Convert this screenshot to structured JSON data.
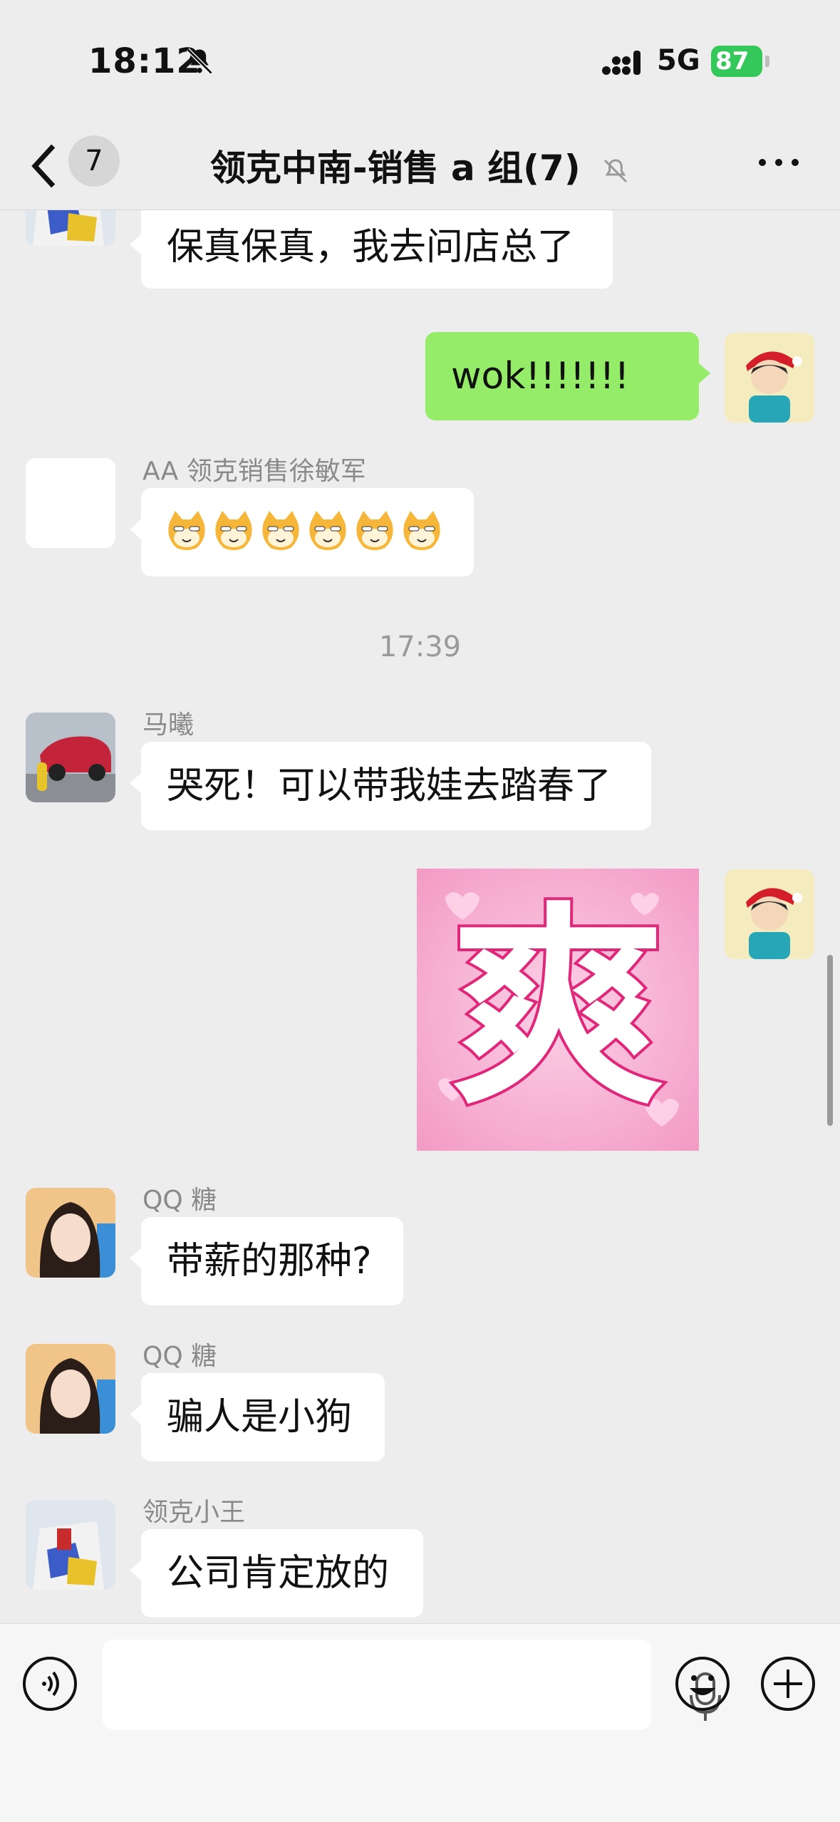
{
  "status_bar": {
    "time": "18:12",
    "network": "5G",
    "battery": "87"
  },
  "nav": {
    "unread_count": "7",
    "title": "领克中南-销售 a 组(7)"
  },
  "messages": [
    {
      "side": "left",
      "sender": "",
      "text": "保真保真，我去问店总了"
    },
    {
      "side": "right",
      "text": "wok!!!!!!!"
    },
    {
      "side": "left",
      "sender": "AA 领克销售徐敏军",
      "emoji": "cat-face-emoji x6"
    },
    {
      "timestamp": "17:39"
    },
    {
      "side": "left",
      "sender": "马曦",
      "text": "哭死！可以带我娃去踏春了"
    },
    {
      "side": "right",
      "sticker": "爽"
    },
    {
      "side": "left",
      "sender": "QQ 糖",
      "text": "带薪的那种?"
    },
    {
      "side": "left",
      "sender": "QQ 糖",
      "text": "骗人是小狗"
    },
    {
      "side": "left",
      "sender": "领克小王",
      "text": "公司肯定放的"
    }
  ],
  "icons": {
    "back": "chevron-left-icon",
    "mute": "bell-slash-icon",
    "more": "more-dots-icon",
    "voice": "voice-icon",
    "mic": "microphone-icon",
    "emoji": "smiley-icon",
    "plus": "plus-icon"
  },
  "colors": {
    "self_bubble": "#95ec69",
    "other_bubble": "#ffffff",
    "background": "#ededed",
    "battery": "#34c759"
  }
}
